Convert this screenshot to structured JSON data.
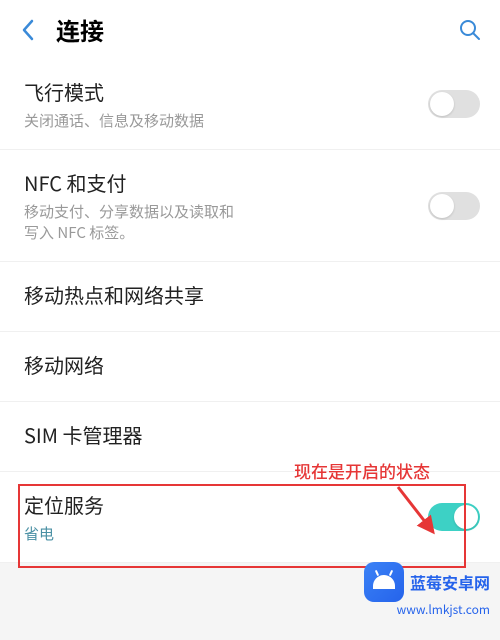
{
  "header": {
    "title": "连接"
  },
  "items": {
    "airplane": {
      "title": "飞行模式",
      "subtitle": "关闭通话、信息及移动数据",
      "on": false
    },
    "nfc": {
      "title": "NFC 和支付",
      "subtitle": "移动支付、分享数据以及读取和写入 NFC 标签。",
      "on": false
    },
    "hotspot": {
      "title": "移动热点和网络共享"
    },
    "mobile_network": {
      "title": "移动网络"
    },
    "sim": {
      "title": "SIM 卡管理器"
    },
    "location": {
      "title": "定位服务",
      "status": "省电",
      "on": true
    }
  },
  "annotation": {
    "text": "现在是开启的状态"
  },
  "watermark": {
    "name": "蓝莓安卓网",
    "url": "www.lmkjst.com"
  }
}
